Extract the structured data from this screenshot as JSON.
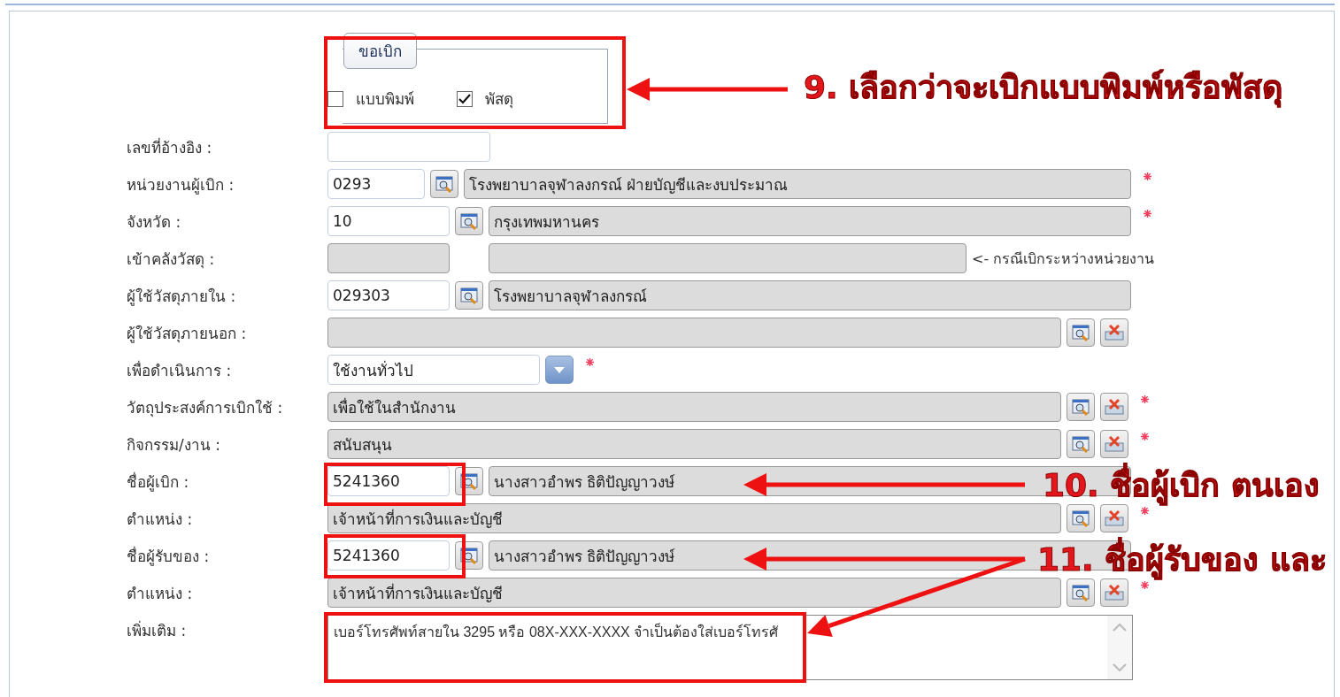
{
  "request_type": {
    "title": "ขอเบิก",
    "options": [
      {
        "label": "แบบพิมพ์",
        "checked": false
      },
      {
        "label": "พัสดุ",
        "checked": true
      }
    ]
  },
  "rows": [
    {
      "kind": "text",
      "label": "เลขที่อ้างอิง :"
    },
    {
      "kind": "lookup",
      "label": "หน่วยงานผู้เบิก :",
      "code": "0293",
      "name": "โรงพยาบาลจุฬาลงกรณ์ ฝ่ายบัญชีและงบประมาณ",
      "required": true
    },
    {
      "kind": "lookup",
      "label": "จังหวัด :",
      "code": "10",
      "name": "กรุงเทพมหานคร",
      "required": true
    },
    {
      "kind": "warehouse",
      "label": "เข้าคลังวัสดุ :",
      "note": "<- กรณีเบิกระหว่างหน่วยงาน"
    },
    {
      "kind": "lookup",
      "label": "ผู้ใช้วัสดุภายใน :",
      "code": "029303",
      "name": "โรงพยาบาลจุฬาลงกรณ์",
      "required": false
    },
    {
      "kind": "wide",
      "label": "ผู้ใช้วัสดุภายนอก :",
      "required": false
    },
    {
      "kind": "select",
      "label": "เพื่อดำเนินการ :",
      "value": "ใช้งานทั่วไป",
      "required": true
    },
    {
      "kind": "wide",
      "label": "วัตถุประสงค์การเบิกใช้ :",
      "value": "เพื่อใช้ในสำนักงาน",
      "required": true
    },
    {
      "kind": "wide",
      "label": "กิจกรรม/งาน :",
      "value": "สนับสนุน",
      "required": true
    },
    {
      "kind": "lookup",
      "label": "ชื่อผู้เบิก :",
      "code": "5241360",
      "name": "นางสาวอำพร ธิติปัญญาวงษ์",
      "required": false
    },
    {
      "kind": "wide",
      "label": "ตำแหน่ง :",
      "value": "เจ้าหน้าที่การเงินและบัญชี",
      "required": true
    },
    {
      "kind": "lookup",
      "label": "ชื่อผู้รับของ :",
      "code": "5241360",
      "name": "นางสาวอำพร ธิติปัญญาวงษ์",
      "required": false
    },
    {
      "kind": "wide",
      "label": "ตำแหน่ง :",
      "value": "เจ้าหน้าที่การเงินและบัญชี",
      "required": true
    },
    {
      "kind": "textarea",
      "label": "เพิ่มเติม :",
      "value": "เบอร์โทรศัพท์สายใน 3295 หรือ 08X-XXX-XXXX  จำเป็นต้องใส่เบอร์โทรศั"
    }
  ],
  "callouts": [
    {
      "text": "9. เลือกว่าจะเบิกแบบพิมพ์หรือพัสดุ"
    },
    {
      "text": "10. ชื่อผู้เบิก ตนเอง"
    },
    {
      "text": "11. ชื่อผู้รับของ และ"
    }
  ]
}
